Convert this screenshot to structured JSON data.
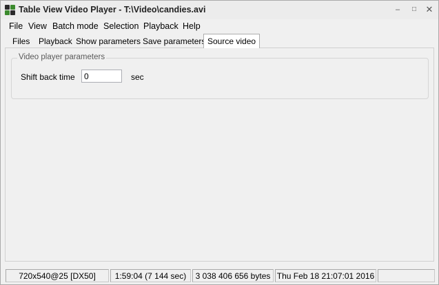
{
  "window": {
    "title": "Table View Video Player - T:\\Video\\candies.avi",
    "app_icon": "app-grid-icon",
    "controls": {
      "minimize": "–",
      "maximize": "□",
      "close": "✕"
    }
  },
  "menu": [
    "File",
    "View",
    "Batch mode",
    "Selection",
    "Playback",
    "Help"
  ],
  "tabs": {
    "items": [
      "Files",
      "Playback",
      "Show parameters",
      "Save parameters",
      "Source video"
    ],
    "active": "Source video"
  },
  "group": {
    "title": "Video player parameters",
    "shift_back_label": "Shift back time",
    "shift_back_value": "0",
    "shift_back_unit": "sec"
  },
  "status": {
    "resolution": "720x540@25 [DX50]",
    "duration": "1:59:04 (7 144 sec)",
    "size": "3 038 406 656 bytes",
    "date": "Thu Feb 18 21:07:01 2016"
  },
  "colors": {
    "accent": "#3b8a2d",
    "window_bg": "#f0f0f0"
  }
}
